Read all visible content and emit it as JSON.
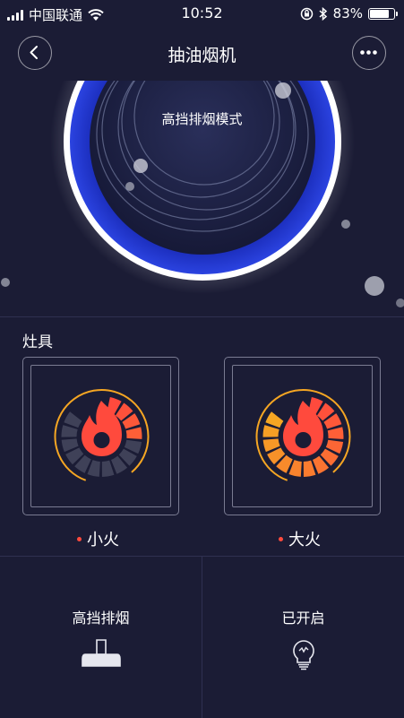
{
  "status_bar": {
    "carrier": "中国联通",
    "time": "10:52",
    "battery_percent": "83%",
    "battery_level": 0.83
  },
  "nav": {
    "title": "抽油烟机"
  },
  "hero": {
    "mode": "高挡排烟模式"
  },
  "burners": {
    "section_title": "灶具",
    "items": [
      {
        "label": "小火",
        "heat_level": 0.35
      },
      {
        "label": "大火",
        "heat_level": 1.0
      }
    ]
  },
  "controls": {
    "fan": {
      "label": "高挡排烟",
      "icon": "range-hood-icon"
    },
    "light": {
      "label": "已开启",
      "icon": "light-bulb-icon"
    }
  },
  "colors": {
    "background": "#1b1c35",
    "accent_blue": "#1c2fbf",
    "flame_red": "#ff4a3d",
    "flame_orange": "#f5a623",
    "status_dot": "#ff4a3d"
  }
}
